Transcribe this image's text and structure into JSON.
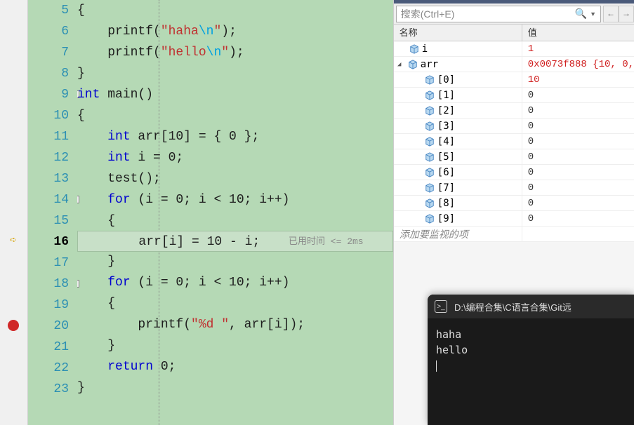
{
  "gutter_lines": [
    "5",
    "6",
    "7",
    "8",
    "9",
    "10",
    "11",
    "12",
    "13",
    "14",
    "15",
    "16",
    "17",
    "18",
    "19",
    "20",
    "21",
    "22",
    "23"
  ],
  "code": {
    "line5": "{",
    "line6_pre": "    printf(",
    "line6_str1": "\"haha",
    "line6_esc": "\\n",
    "line6_str2": "\"",
    "line6_post": ");",
    "line7_pre": "    printf(",
    "line7_str1": "\"hello",
    "line7_esc": "\\n",
    "line7_str2": "\"",
    "line7_post": ");",
    "line8": "}",
    "line9_kw": "int",
    "line9_rest": " main()",
    "line10": "{",
    "line11_pre": "    ",
    "line11_kw": "int",
    "line11_rest": " arr[10] = { 0 };",
    "line12_pre": "    ",
    "line12_kw": "int",
    "line12_rest": " i = 0;",
    "line13": "    test();",
    "line14_pre": "    ",
    "line14_kw": "for",
    "line14_rest": " (i = 0; i < 10; i++)",
    "line15": "    {",
    "line16": "        arr[i] = 10 - i;",
    "line16_timing": "已用时间 <= 2ms",
    "line17": "    }",
    "line18_pre": "    ",
    "line18_kw": "for",
    "line18_rest": " (i = 0; i < 10; i++)",
    "line19": "    {",
    "line20_pre": "        printf(",
    "line20_str": "\"%d \"",
    "line20_post": ", arr[i]);",
    "line21": "    }",
    "line22_pre": "    ",
    "line22_kw": "return",
    "line22_rest": " 0;",
    "line23": "}"
  },
  "watch": {
    "search_placeholder": "搜索(Ctrl+E)",
    "header_name": "名称",
    "header_value": "值",
    "rows": [
      {
        "indent": 18,
        "expand": "",
        "icon": "var",
        "name": "i",
        "value": "1",
        "red": true
      },
      {
        "indent": 0,
        "expand": "▢",
        "icon": "var",
        "name": "arr",
        "value": "0x0073f888 {10, 0,",
        "red": true
      },
      {
        "indent": 40,
        "expand": "",
        "icon": "var",
        "name": "[0]",
        "value": "10",
        "red": true
      },
      {
        "indent": 40,
        "expand": "",
        "icon": "var",
        "name": "[1]",
        "value": "0",
        "red": false
      },
      {
        "indent": 40,
        "expand": "",
        "icon": "var",
        "name": "[2]",
        "value": "0",
        "red": false
      },
      {
        "indent": 40,
        "expand": "",
        "icon": "var",
        "name": "[3]",
        "value": "0",
        "red": false
      },
      {
        "indent": 40,
        "expand": "",
        "icon": "var",
        "name": "[4]",
        "value": "0",
        "red": false
      },
      {
        "indent": 40,
        "expand": "",
        "icon": "var",
        "name": "[5]",
        "value": "0",
        "red": false
      },
      {
        "indent": 40,
        "expand": "",
        "icon": "var",
        "name": "[6]",
        "value": "0",
        "red": false
      },
      {
        "indent": 40,
        "expand": "",
        "icon": "var",
        "name": "[7]",
        "value": "0",
        "red": false
      },
      {
        "indent": 40,
        "expand": "",
        "icon": "var",
        "name": "[8]",
        "value": "0",
        "red": false
      },
      {
        "indent": 40,
        "expand": "",
        "icon": "var",
        "name": "[9]",
        "value": "0",
        "red": false
      }
    ],
    "add_item": "添加要监视的项"
  },
  "console": {
    "title": "D:\\编程合集\\C语言合集\\Git远",
    "lines": [
      "haha",
      "hello"
    ]
  }
}
